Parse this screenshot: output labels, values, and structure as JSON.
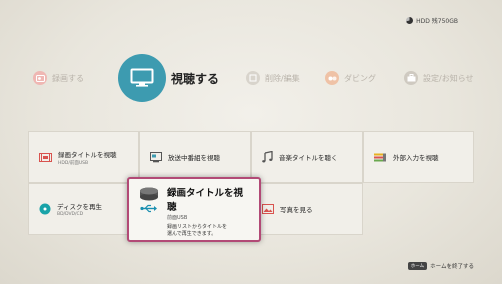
{
  "status": {
    "hdd_label": "HDD 残750GB"
  },
  "top_menu": [
    {
      "label": "録画する",
      "icon": "record-icon",
      "active": false
    },
    {
      "label": "視聴する",
      "icon": "tv-icon",
      "active": true
    },
    {
      "label": "削除/編集",
      "icon": "edit-icon",
      "active": false
    },
    {
      "label": "ダビング",
      "icon": "dubbing-icon",
      "active": false
    },
    {
      "label": "設定/お知らせ",
      "icon": "settings-toolbox-icon",
      "active": false
    }
  ],
  "tiles": {
    "rec_title": {
      "label": "録画タイトルを視聴",
      "sub": "HDD/前面USB"
    },
    "broadcast": {
      "label": "放送中番組を視聴"
    },
    "music": {
      "label": "音楽タイトルを聴く"
    },
    "external": {
      "label": "外部入力を視聴"
    },
    "disc": {
      "label": "ディスクを再生",
      "sub": "BD/DVD/CD"
    },
    "selected": {
      "label": "録画タイトルを視聴",
      "sub": "前面USB",
      "desc1": "録画リストからタイトルを",
      "desc2": "選んで再生できます。"
    },
    "photo": {
      "label": "写真を見る"
    }
  },
  "footer": {
    "key": "ホーム",
    "label": "ホームを終了する"
  },
  "colors": {
    "accent": "#3d9bb0",
    "selection": "#b24a76"
  }
}
